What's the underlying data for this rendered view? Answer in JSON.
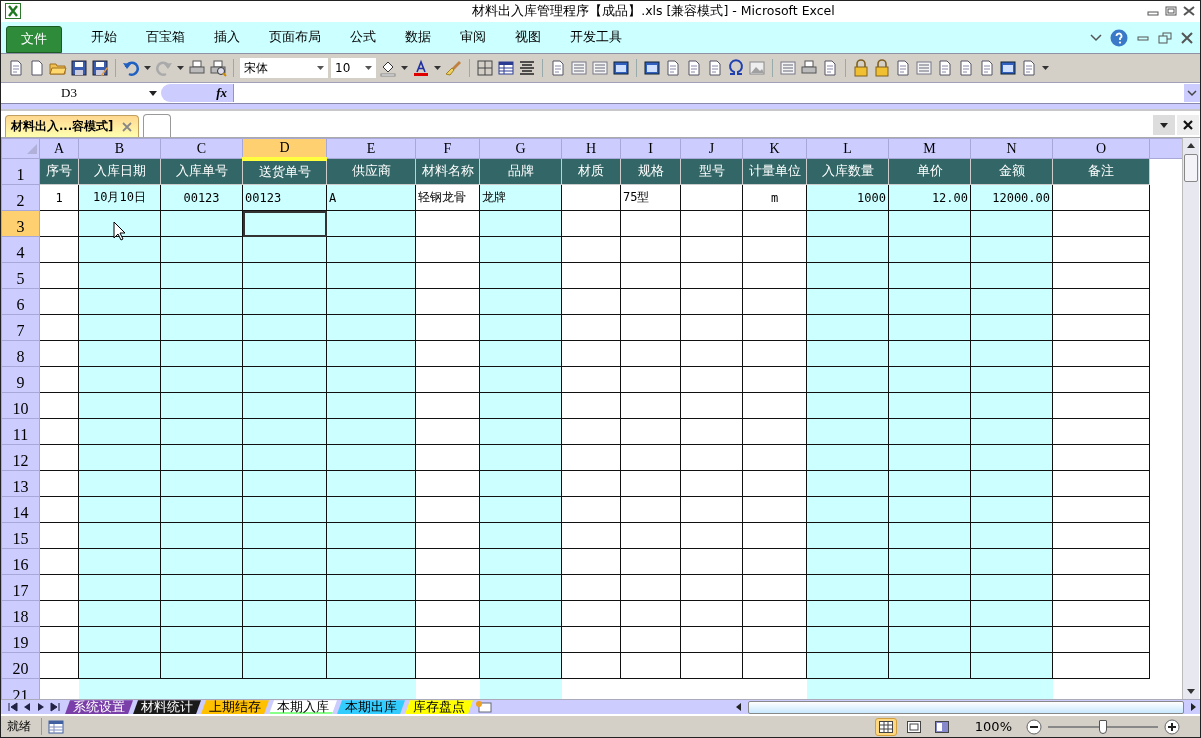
{
  "window": {
    "title": "材料出入库管理程序【成品】.xls  [兼容模式]  -  Microsoft Excel"
  },
  "ribbon": {
    "file_button": "文件",
    "tabs": [
      "开始",
      "百宝箱",
      "插入",
      "页面布局",
      "公式",
      "数据",
      "审阅",
      "视图",
      "开发工具"
    ]
  },
  "toolbar": {
    "font": "宋体",
    "font_size": "10"
  },
  "formula_bar": {
    "name_box": "D3",
    "fx": "fx"
  },
  "document_tab": {
    "label": "材料出入...容模式]"
  },
  "sheet": {
    "columns": [
      {
        "letter": "A",
        "heading": "序号",
        "shaded": false,
        "selected": false
      },
      {
        "letter": "B",
        "heading": "入库日期",
        "shaded": true,
        "selected": false
      },
      {
        "letter": "C",
        "heading": "入库单号",
        "shaded": true,
        "selected": false
      },
      {
        "letter": "D",
        "heading": "送货单号",
        "shaded": true,
        "selected": true
      },
      {
        "letter": "E",
        "heading": "供应商",
        "shaded": true,
        "selected": false
      },
      {
        "letter": "F",
        "heading": "材料名称",
        "shaded": false,
        "selected": false
      },
      {
        "letter": "G",
        "heading": "品牌",
        "shaded": true,
        "selected": false
      },
      {
        "letter": "H",
        "heading": "材质",
        "shaded": false,
        "selected": false
      },
      {
        "letter": "I",
        "heading": "规格",
        "shaded": false,
        "selected": false
      },
      {
        "letter": "J",
        "heading": "型号",
        "shaded": false,
        "selected": false
      },
      {
        "letter": "K",
        "heading": "计量单位",
        "shaded": false,
        "selected": false
      },
      {
        "letter": "L",
        "heading": "入库数量",
        "shaded": true,
        "selected": false
      },
      {
        "letter": "M",
        "heading": "单价",
        "shaded": true,
        "selected": false
      },
      {
        "letter": "N",
        "heading": "金额",
        "shaded": true,
        "selected": false
      },
      {
        "letter": "O",
        "heading": "备注",
        "shaded": false,
        "selected": false
      }
    ],
    "rows": [
      {
        "number": "1",
        "kind": "header",
        "selected": false
      },
      {
        "number": "2",
        "kind": "data",
        "selected": false,
        "cells": [
          "1",
          "10月10日",
          "00123",
          "00123",
          "A",
          "轻钢龙骨",
          "龙牌",
          null,
          "75型",
          null,
          "m",
          "1000",
          "12.00",
          "12000.00",
          null
        ]
      },
      {
        "number": "3",
        "kind": "empty",
        "selected": true
      },
      {
        "number": "4",
        "kind": "empty",
        "selected": false
      },
      {
        "number": "5",
        "kind": "empty",
        "selected": false
      },
      {
        "number": "6",
        "kind": "empty",
        "selected": false
      },
      {
        "number": "7",
        "kind": "empty",
        "selected": false
      },
      {
        "number": "8",
        "kind": "empty",
        "selected": false
      },
      {
        "number": "9",
        "kind": "empty",
        "selected": false
      },
      {
        "number": "10",
        "kind": "empty",
        "selected": false
      },
      {
        "number": "11",
        "kind": "empty",
        "selected": false
      },
      {
        "number": "12",
        "kind": "empty",
        "selected": false
      },
      {
        "number": "13",
        "kind": "empty",
        "selected": false
      },
      {
        "number": "14",
        "kind": "empty",
        "selected": false
      },
      {
        "number": "15",
        "kind": "empty",
        "selected": false
      },
      {
        "number": "16",
        "kind": "empty",
        "selected": false
      },
      {
        "number": "17",
        "kind": "empty",
        "selected": false
      },
      {
        "number": "18",
        "kind": "empty",
        "selected": false
      },
      {
        "number": "19",
        "kind": "empty",
        "selected": false
      },
      {
        "number": "20",
        "kind": "empty",
        "selected": false
      },
      {
        "number": "21",
        "kind": "empty",
        "selected": false
      }
    ]
  },
  "sheet_tabs": [
    {
      "label": "系统设置",
      "color": "#7a3fa8",
      "selected": false
    },
    {
      "label": "材料统计",
      "color": "#1a1a1a",
      "selected": false
    },
    {
      "label": "上期结存",
      "color": "#ffc000",
      "selected": false
    },
    {
      "label": "本期入库",
      "color": "#ffffff",
      "selected": true
    },
    {
      "label": "本期出库",
      "color": "#33ccff",
      "selected": false
    },
    {
      "label": "库存盘点",
      "color": "#ffff00",
      "selected": false
    }
  ],
  "status_bar": {
    "text": "就绪",
    "views": [
      {
        "kind": "normal",
        "selected": true
      },
      {
        "kind": "page_layout",
        "selected": false
      },
      {
        "kind": "page_break",
        "selected": false
      }
    ],
    "zoom": "100%",
    "zoom_slider": {
      "level": 0.5
    }
  }
}
